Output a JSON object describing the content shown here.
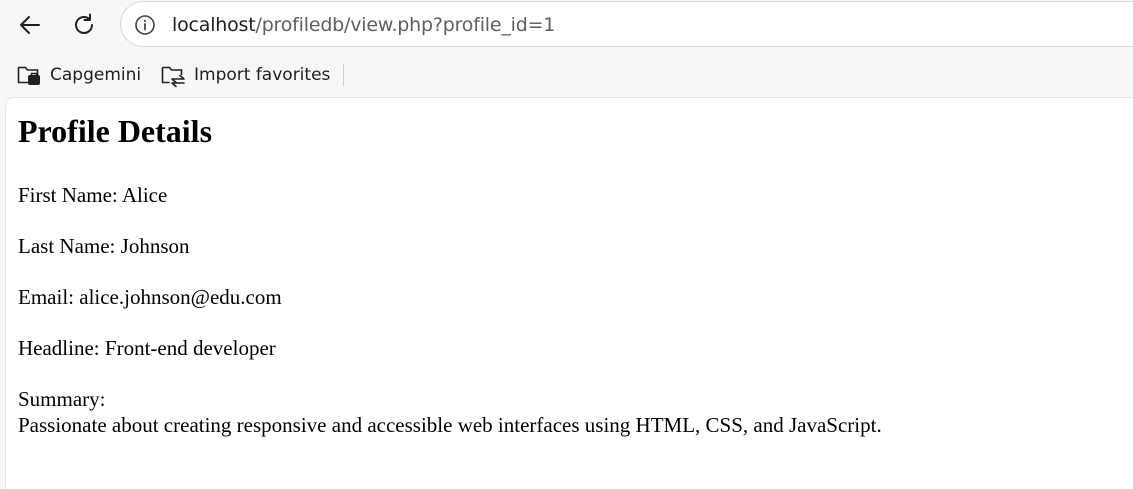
{
  "address_bar": {
    "host": "localhost",
    "path": "/profiledb/view.php?profile_id=1"
  },
  "favorites": [
    {
      "label": "Capgemini",
      "icon": "folder-icon"
    },
    {
      "label": "Import favorites",
      "icon": "import-favorites-icon"
    }
  ],
  "page": {
    "title": "Profile Details",
    "fields": {
      "first_name": {
        "label": "First Name:",
        "value": "Alice"
      },
      "last_name": {
        "label": "Last Name:",
        "value": "Johnson"
      },
      "email": {
        "label": "Email:",
        "value": "alice.johnson@edu.com"
      },
      "headline": {
        "label": "Headline:",
        "value": "Front-end developer"
      },
      "summary": {
        "label": "Summary:",
        "value": "Passionate about creating responsive and accessible web interfaces using HTML, CSS, and JavaScript."
      }
    }
  }
}
